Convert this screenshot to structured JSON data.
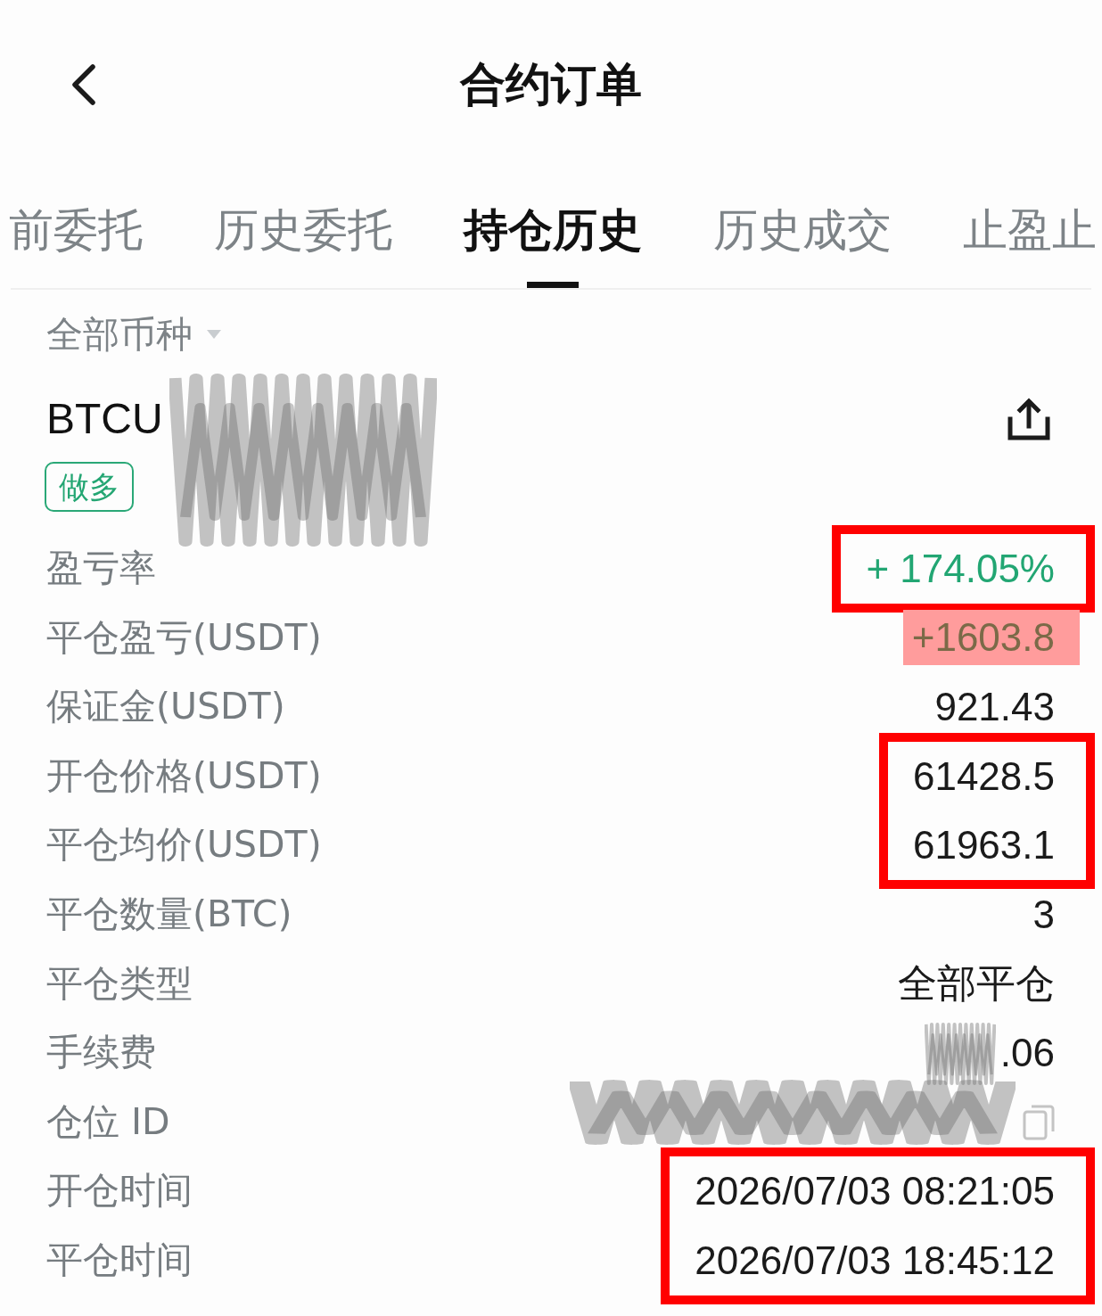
{
  "header": {
    "title": "合约订单"
  },
  "tabs": [
    {
      "label": "前委托",
      "selected": false
    },
    {
      "label": "历史委托",
      "selected": false
    },
    {
      "label": "持仓历史",
      "selected": true
    },
    {
      "label": "历史成交",
      "selected": false
    },
    {
      "label": "止盈止",
      "selected": false
    }
  ],
  "filter": {
    "label": "全部币种"
  },
  "position": {
    "symbol": "BTCU",
    "redacted": true,
    "side": "做多"
  },
  "details": [
    {
      "frame": true,
      "rows": [
        {
          "label": "盈亏率",
          "value": "+ 174.05%",
          "kind": "profit"
        }
      ]
    },
    {
      "frame": false,
      "rows": [
        {
          "label": "平仓盈亏(USDT)",
          "value": "+1603.8",
          "kind": "profit",
          "highlight": true
        },
        {
          "label": "保证金(USDT)",
          "value": "921.43",
          "kind": "plain"
        }
      ]
    },
    {
      "frame": true,
      "rows": [
        {
          "label": "开仓价格(USDT)",
          "value": "61428.5",
          "kind": "plain"
        },
        {
          "label": "平仓均价(USDT)",
          "value": "61963.1",
          "kind": "plain"
        }
      ]
    },
    {
      "frame": false,
      "rows": [
        {
          "label": "平仓数量(BTC)",
          "value": "3",
          "kind": "plain"
        },
        {
          "label": "平仓类型",
          "value": "全部平仓",
          "kind": "plain"
        },
        {
          "label": "手续费",
          "value": ".06",
          "kind": "plain",
          "redacted": true
        },
        {
          "label": "仓位 ID",
          "kind": "id",
          "redacted": true
        }
      ]
    },
    {
      "frame": true,
      "rows": [
        {
          "label": "开仓时间",
          "value": "2026/07/03 08:21:05",
          "kind": "plain"
        },
        {
          "label": "平仓时间",
          "value": "2026/07/03 18:45:12",
          "kind": "plain"
        }
      ]
    }
  ]
}
